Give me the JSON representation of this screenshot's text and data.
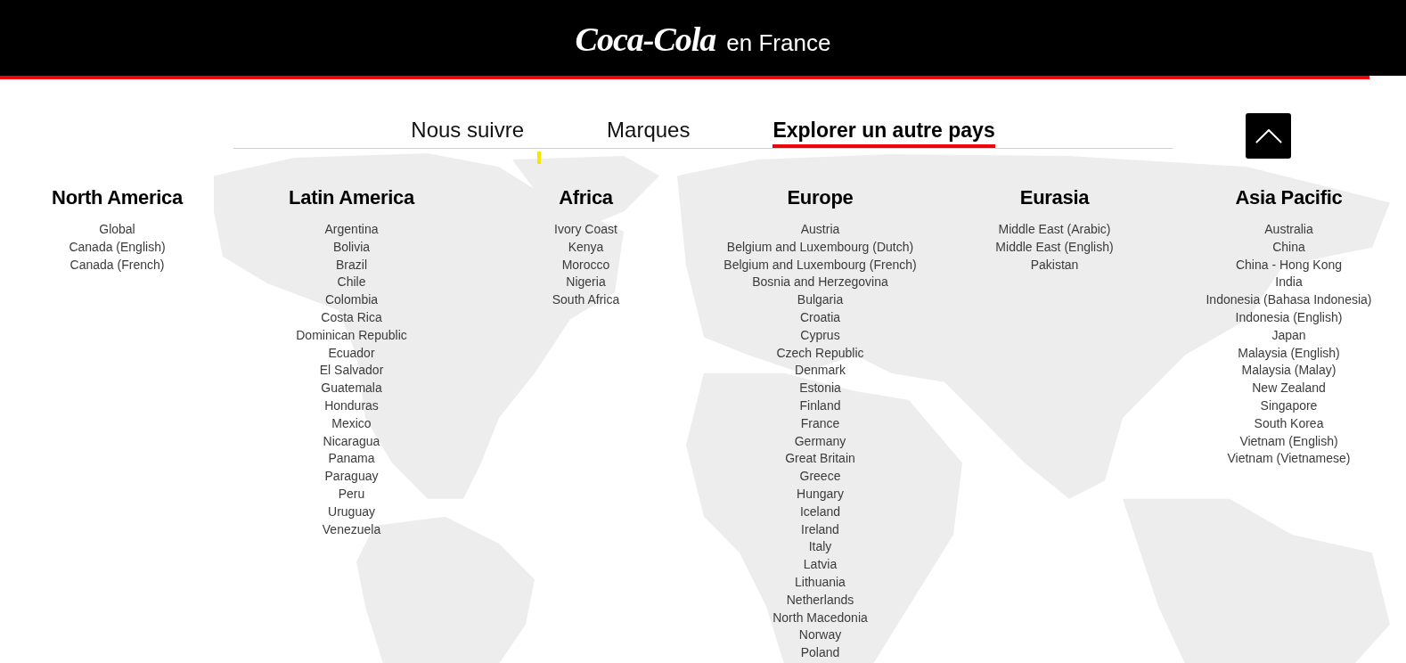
{
  "header": {
    "logo": "Coca-Cola",
    "site_name": "en France"
  },
  "nav": {
    "tabs": [
      {
        "label": "Nous suivre",
        "selected": false
      },
      {
        "label": "Marques",
        "selected": false
      },
      {
        "label": "Explorer un autre pays",
        "selected": true
      }
    ]
  },
  "regions": [
    {
      "name": "North America",
      "countries": [
        "Global",
        "Canada (English)",
        "Canada (French)"
      ]
    },
    {
      "name": "Latin America",
      "countries": [
        "Argentina",
        "Bolivia",
        "Brazil",
        "Chile",
        "Colombia",
        "Costa Rica",
        "Dominican Republic",
        "Ecuador",
        "El Salvador",
        "Guatemala",
        "Honduras",
        "Mexico",
        "Nicaragua",
        "Panama",
        "Paraguay",
        "Peru",
        "Uruguay",
        "Venezuela"
      ]
    },
    {
      "name": "Africa",
      "countries": [
        "Ivory Coast",
        "Kenya",
        "Morocco",
        "Nigeria",
        "South Africa"
      ]
    },
    {
      "name": "Europe",
      "countries": [
        "Austria",
        "Belgium and Luxembourg (Dutch)",
        "Belgium and Luxembourg (French)",
        "Bosnia and Herzegovina",
        "Bulgaria",
        "Croatia",
        "Cyprus",
        "Czech Republic",
        "Denmark",
        "Estonia",
        "Finland",
        "France",
        "Germany",
        "Great Britain",
        "Greece",
        "Hungary",
        "Iceland",
        "Ireland",
        "Italy",
        "Latvia",
        "Lithuania",
        "Netherlands",
        "North Macedonia",
        "Norway",
        "Poland"
      ]
    },
    {
      "name": "Eurasia",
      "countries": [
        "Middle East (Arabic)",
        "Middle East (English)",
        "Pakistan"
      ]
    },
    {
      "name": "Asia Pacific",
      "countries": [
        "Australia",
        "China",
        "China - Hong Kong",
        "India",
        "Indonesia (Bahasa Indonesia)",
        "Indonesia (English)",
        "Japan",
        "Malaysia (English)",
        "Malaysia (Malay)",
        "New Zealand",
        "Singapore",
        "South Korea",
        "Vietnam (English)",
        "Vietnam (Vietnamese)"
      ]
    }
  ]
}
